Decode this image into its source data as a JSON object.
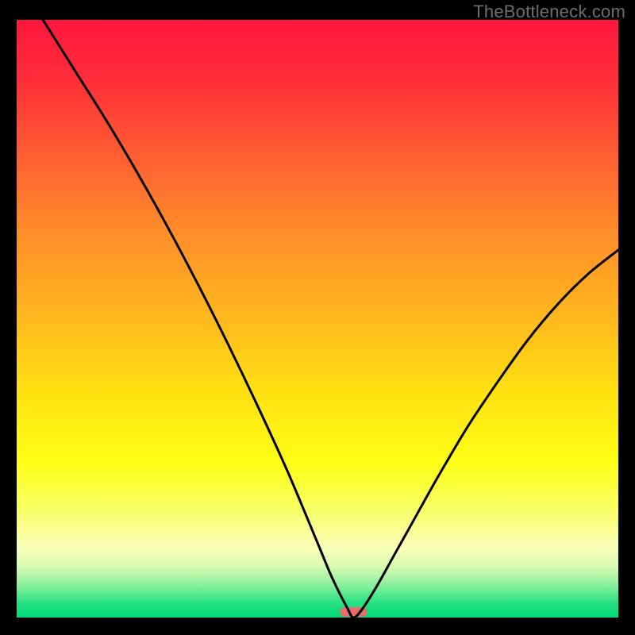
{
  "attribution": "TheBottleneck.com",
  "chart_data": {
    "type": "line",
    "title": "",
    "xlabel": "",
    "ylabel": "",
    "xlim": [
      0,
      1
    ],
    "ylim": [
      0,
      1
    ],
    "series": [
      {
        "name": "curve",
        "x": [
          0.0,
          0.05,
          0.1,
          0.15,
          0.2,
          0.25,
          0.3,
          0.35,
          0.4,
          0.45,
          0.5,
          0.525,
          0.55,
          0.56,
          0.575,
          0.6,
          0.625,
          0.65,
          0.7,
          0.75,
          0.8,
          0.85,
          0.9,
          0.95,
          1.0
        ],
        "y": [
          1.07,
          0.99,
          0.91,
          0.83,
          0.745,
          0.655,
          0.56,
          0.46,
          0.355,
          0.245,
          0.125,
          0.065,
          0.015,
          0.0,
          0.015,
          0.055,
          0.1,
          0.145,
          0.235,
          0.32,
          0.395,
          0.465,
          0.525,
          0.575,
          0.615
        ]
      }
    ],
    "marker": {
      "x": 0.56,
      "width": 0.045,
      "color": "#ea6a6e"
    },
    "gradient_stops": [
      {
        "offset": 0.0,
        "color": "#ff173c"
      },
      {
        "offset": 0.1,
        "color": "#ff2e39"
      },
      {
        "offset": 0.22,
        "color": "#ff5b32"
      },
      {
        "offset": 0.35,
        "color": "#ff8b2a"
      },
      {
        "offset": 0.48,
        "color": "#ffb21f"
      },
      {
        "offset": 0.62,
        "color": "#ffe012"
      },
      {
        "offset": 0.74,
        "color": "#fdff14"
      },
      {
        "offset": 0.82,
        "color": "#f8ff66"
      },
      {
        "offset": 0.88,
        "color": "#fbffb8"
      },
      {
        "offset": 0.915,
        "color": "#d7fab0"
      },
      {
        "offset": 0.945,
        "color": "#8df09e"
      },
      {
        "offset": 0.975,
        "color": "#27e283"
      },
      {
        "offset": 1.0,
        "color": "#00d877"
      }
    ]
  }
}
